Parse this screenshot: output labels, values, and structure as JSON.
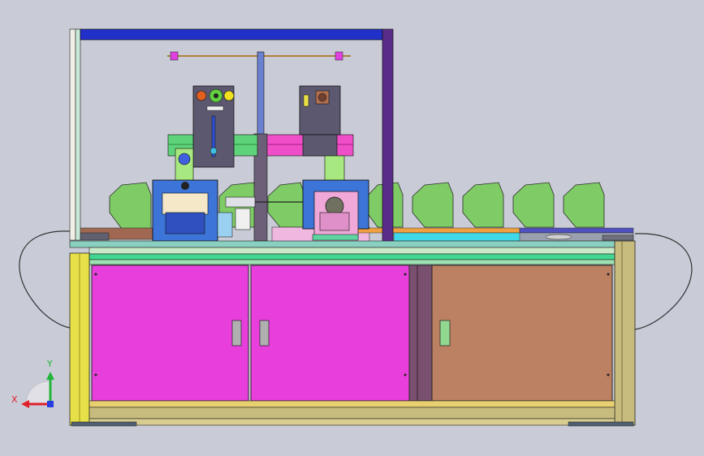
{
  "view": {
    "background": "#c9ccd6"
  },
  "triad": {
    "x_label": "X",
    "y_label": "Y",
    "x_color": "#e0202a",
    "y_color": "#22b33a",
    "z_color": "#2a3ce0"
  },
  "colors": {
    "door": "#e83fdc",
    "door_right": "#bb8162",
    "frame_yellow": "#e8e048",
    "frame_olive": "#c7bb7d",
    "frame_top_blue": "#2130c8",
    "post_purple": "#5a2c8a",
    "rail_green": "#5fd37a",
    "rail_pink": "#f04ec8",
    "panel_dark": "#5c5870",
    "base_blue": "#3c74d8",
    "hopper_green": "#7fcc66",
    "cover_outline": "#333333"
  }
}
